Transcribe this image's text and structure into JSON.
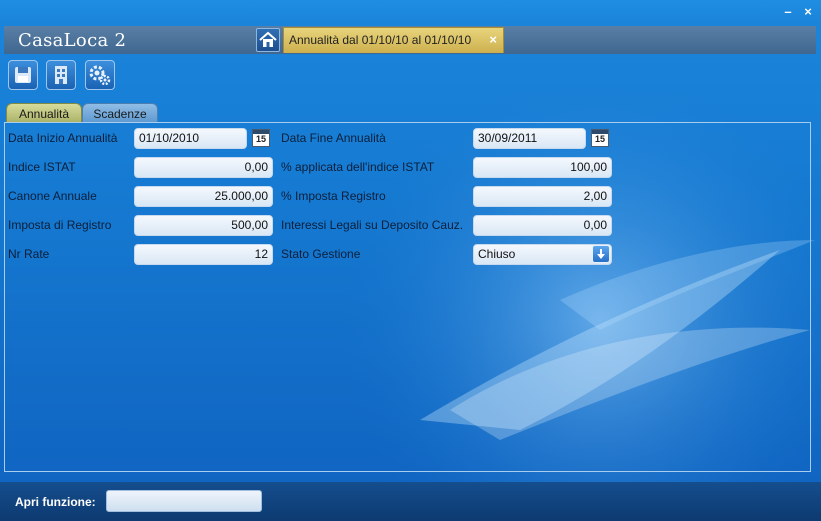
{
  "app": {
    "title": "CasaLoca 2"
  },
  "window_controls": {
    "minimize": "–",
    "close": "×"
  },
  "doc_tab": {
    "label": "Annualità dal 01/10/10 al 01/10/10",
    "close": "×"
  },
  "toolbar": {
    "icons": [
      "save-icon",
      "building-icon",
      "settings-gears-icon"
    ]
  },
  "tabs": [
    {
      "label": "Annualità",
      "active": true
    },
    {
      "label": "Scadenze",
      "active": false
    }
  ],
  "form": {
    "data_inizio": {
      "label": "Data Inizio Annualità",
      "value": "01/10/2010"
    },
    "data_fine": {
      "label": "Data Fine Annualità",
      "value": "30/09/2011"
    },
    "indice_istat": {
      "label": "Indice ISTAT",
      "value": "0,00"
    },
    "perc_istat": {
      "label": "% applicata dell'indice ISTAT",
      "value": "100,00"
    },
    "canone": {
      "label": "Canone Annuale",
      "value": "25.000,00"
    },
    "perc_imposta": {
      "label": "% Imposta Registro",
      "value": "2,00"
    },
    "imposta_registro": {
      "label": "Imposta di Registro",
      "value": "500,00"
    },
    "interessi": {
      "label": "Interessi Legali su Deposito Cauz.",
      "value": "0,00"
    },
    "nr_rate": {
      "label": "Nr Rate",
      "value": "12"
    },
    "stato": {
      "label": "Stato Gestione",
      "value": "Chiuso"
    },
    "calendar_day": "15"
  },
  "footer": {
    "label": "Apri funzione:",
    "input_value": ""
  },
  "colors": {
    "background": "#1577cf",
    "tab_active": "#cdb04e",
    "header": "#3f678f"
  }
}
